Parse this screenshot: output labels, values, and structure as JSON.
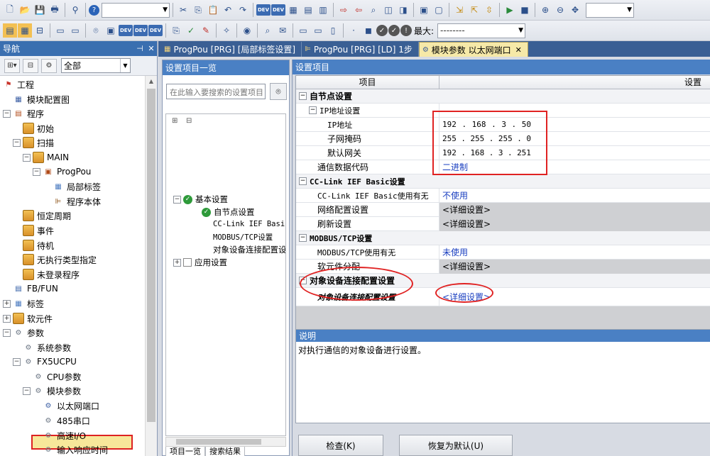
{
  "toolbar2": {
    "max_label": "最大:",
    "max_value": "--------"
  },
  "nav": {
    "title": "导航",
    "filter_value": "全部",
    "tree": [
      {
        "label": "工程"
      },
      {
        "label": "模块配置图"
      },
      {
        "label": "程序"
      },
      {
        "label": "初始"
      },
      {
        "label": "扫描"
      },
      {
        "label": "MAIN"
      },
      {
        "label": "ProgPou"
      },
      {
        "label": "局部标签"
      },
      {
        "label": "程序本体"
      },
      {
        "label": "恒定周期"
      },
      {
        "label": "事件"
      },
      {
        "label": "待机"
      },
      {
        "label": "无执行类型指定"
      },
      {
        "label": "未登录程序"
      },
      {
        "label": "FB/FUN"
      },
      {
        "label": "标签"
      },
      {
        "label": "软元件"
      },
      {
        "label": "参数"
      },
      {
        "label": "系统参数"
      },
      {
        "label": "FX5UCPU"
      },
      {
        "label": "CPU参数"
      },
      {
        "label": "模块参数"
      },
      {
        "label": "以太网端口"
      },
      {
        "label": "485串口"
      },
      {
        "label": "高速I/O"
      },
      {
        "label": "输入响应时间"
      }
    ]
  },
  "tabs": [
    {
      "label": "ProgPou [PRG] [局部标签设置]"
    },
    {
      "label": "ProgPou [PRG] [LD] 1步"
    },
    {
      "label": "模块参数 以太网端口"
    }
  ],
  "setlist": {
    "title": "设置项目一览",
    "search_placeholder": "在此输入要搜索的设置项目",
    "tree": [
      {
        "label": "基本设置"
      },
      {
        "label": "自节点设置"
      },
      {
        "label": "CC-Link IEF Basic"
      },
      {
        "label": "MODBUS/TCP设置"
      },
      {
        "label": "对象设备连接配置设"
      },
      {
        "label": "应用设置"
      }
    ],
    "bottom_tabs": [
      "项目一览",
      "搜索结果"
    ]
  },
  "items": {
    "title": "设置项目",
    "col_item": "项目",
    "col_setting": "设置",
    "sec_own_node": "自节点设置",
    "grp_ip": "IP地址设置",
    "ip_label": "IP地址",
    "ip": [
      "192",
      "168",
      "3",
      "50"
    ],
    "mask_label": "子网掩码",
    "mask": [
      "255",
      "255",
      "255",
      "0"
    ],
    "gw_label": "默认网关",
    "gw": [
      "192",
      "168",
      "3",
      "251"
    ],
    "code_label": "通信数据代码",
    "code_value": "二进制",
    "sec_cclink": "CC-Link IEF Basic设置",
    "cclink_use_label": "CC-Link IEF Basic使用有无",
    "cclink_use_value": "不使用",
    "net_config_label": "网络配置设置",
    "net_config_value": "<详细设置>",
    "refresh_label": "刷新设置",
    "refresh_value": "<详细设置>",
    "sec_modbus": "MODBUS/TCP设置",
    "modbus_use_label": "MODBUS/TCP使用有无",
    "modbus_use_value": "未使用",
    "device_assign_label": "软元件分配",
    "device_assign_value": "<详细设置>",
    "sec_target": "对象设备连接配置设置",
    "target_label": "对象设备连接配置设置",
    "target_value": "<详细设置>"
  },
  "desc": {
    "title": "说明",
    "text": "对执行通信的对象设备进行设置。"
  },
  "buttons": {
    "check": "检查(K)",
    "restore": "恢复为默认(U)"
  }
}
